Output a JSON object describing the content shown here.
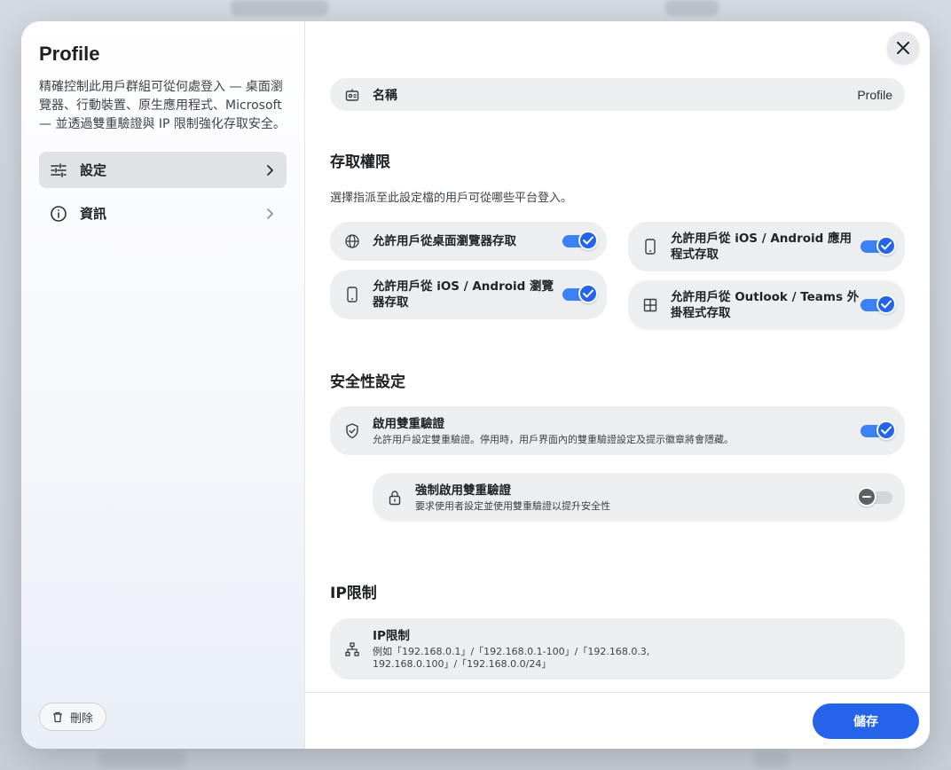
{
  "sidebar": {
    "title": "Profile",
    "description": "精確控制此用戶群組可從何處登入 — 桌面瀏覽器、行動裝置、原生應用程式、Microsoft — 並透過雙重驗證與 IP 限制強化存取安全。",
    "items": [
      {
        "label": "設定",
        "icon": "sliders-icon",
        "active": true
      },
      {
        "label": "資訊",
        "icon": "info-icon",
        "active": false
      }
    ],
    "delete_label": "刪除"
  },
  "name_row": {
    "label": "名稱",
    "value": "Profile",
    "icon": "id-card-icon"
  },
  "access": {
    "title": "存取權限",
    "description": "選擇指派至此設定檔的用戶可從哪些平台登入。",
    "options": [
      {
        "label": "允許用戶從桌面瀏覽器存取",
        "icon": "globe-icon",
        "enabled": true
      },
      {
        "label": "允許用戶從 iOS / Android 應用程式存取",
        "icon": "phone-icon",
        "enabled": true
      },
      {
        "label": "允許用戶從 iOS / Android 瀏覽器存取",
        "icon": "phone-icon",
        "enabled": true
      },
      {
        "label": "允許用戶從 Outlook / Teams 外掛程式存取",
        "icon": "grid-icon",
        "enabled": true
      }
    ]
  },
  "security": {
    "title": "安全性設定",
    "two_factor": {
      "label": "啟用雙重驗證",
      "description": "允許用戶設定雙重驗證。停用時，用戶界面內的雙重驗證設定及提示徽章將會隱藏。",
      "enabled": true
    },
    "force_two_factor": {
      "label": "強制啟用雙重驗證",
      "description": "要求使用者設定並使用雙重驗證以提升安全性",
      "enabled": false
    }
  },
  "ip": {
    "title": "IP限制",
    "card_label": "IP限制",
    "example": "例如「192.168.0.1」/「192.168.0.1-100」/「192.168.0.3, 192.168.0.100」/「192.168.0.0/24」"
  },
  "footer": {
    "save_label": "儲存"
  },
  "colors": {
    "accent": "#2563eb",
    "card_bg": "#eceef0"
  }
}
